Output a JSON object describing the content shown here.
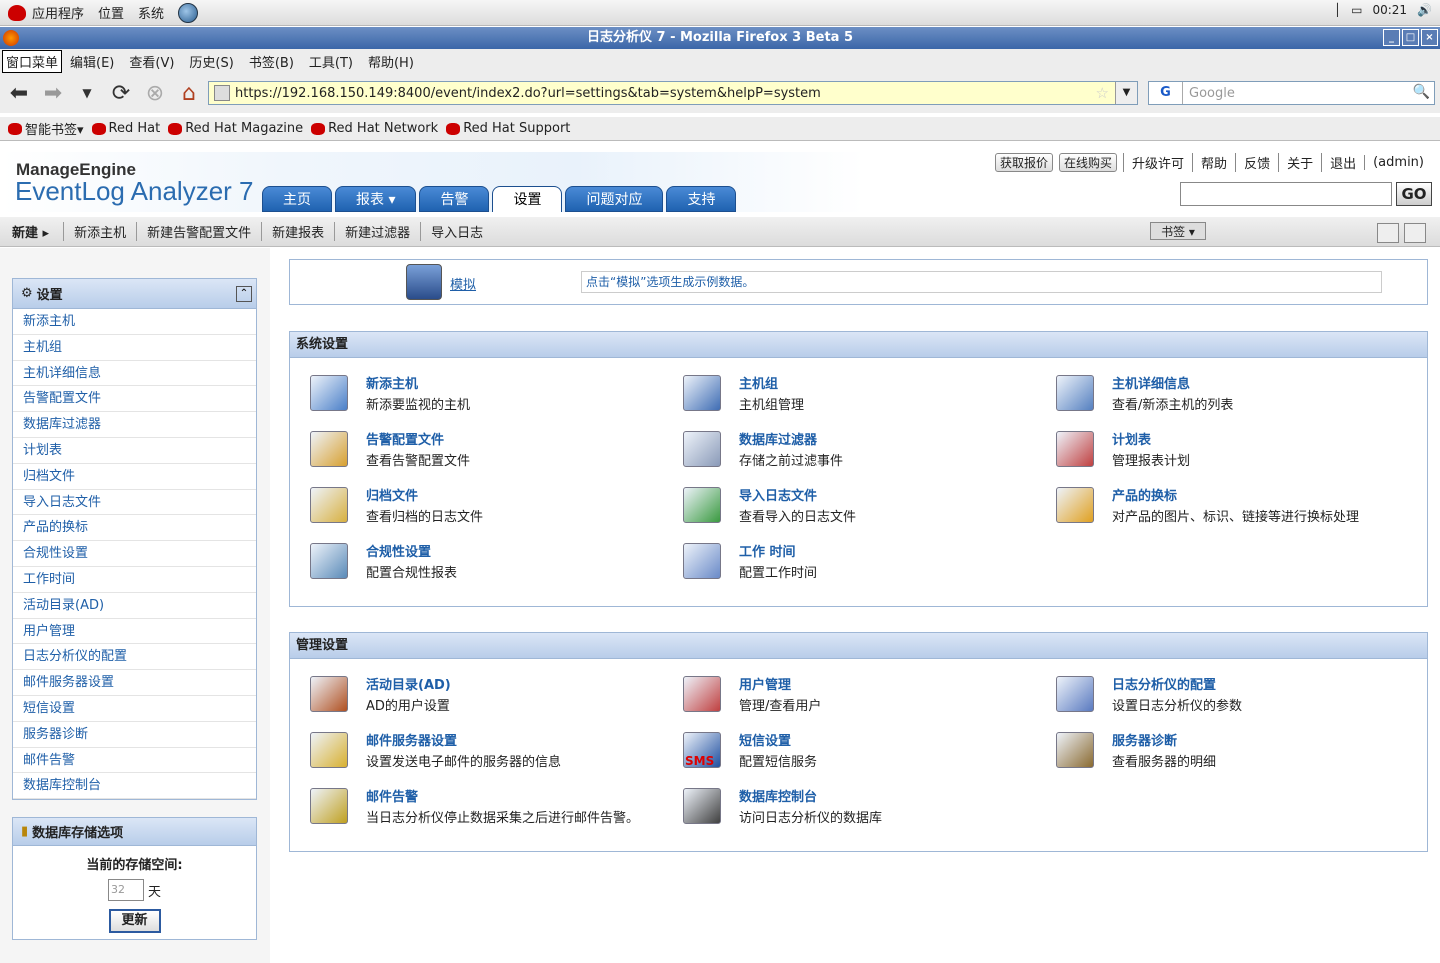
{
  "desktop": {
    "apps": "应用程序",
    "places": "位置",
    "system": "系统",
    "clock": "00:21"
  },
  "window": {
    "title": "日志分析仪 7 -  Mozilla Firefox 3 Beta 5"
  },
  "menu": {
    "items": [
      "窗口菜单",
      "编辑(E)",
      "查看(V)",
      "历史(S)",
      "书签(B)",
      "工具(T)",
      "帮助(H)"
    ]
  },
  "nav": {
    "url": "https://192.168.150.149:8400/event/index2.do?url=settings&tab=system&helpP=system",
    "search_placeholder": "Google",
    "search_engine": "G"
  },
  "bookmarks": [
    "智能书签▾",
    "Red Hat",
    "Red Hat Magazine",
    "Red Hat Network",
    "Red Hat Support"
  ],
  "brand": {
    "line1": "ManageEngine",
    "line2": "EventLog Analyzer 7"
  },
  "tabs": [
    "主页",
    "报表 ▾",
    "告警",
    "设置",
    "问题对应",
    "支持"
  ],
  "header_links": {
    "quote": "获取报价",
    "buy": "在线购买",
    "links": [
      "升级许可",
      "帮助",
      "反馈",
      "关于",
      "退出",
      "(admin)"
    ],
    "go": "GO"
  },
  "subbar": {
    "new": "新建 ▸",
    "items": [
      "新添主机",
      "新建告警配置文件",
      "新建报表",
      "新建过滤器",
      "导入日志"
    ],
    "bookmark": "书签 ▾"
  },
  "sidebar": {
    "title": "设置",
    "items": [
      "新添主机",
      "主机组",
      "主机详细信息",
      "告警配置文件",
      "数据库过滤器",
      "计划表",
      "归档文件",
      "导入日志文件",
      "产品的换标",
      "合规性设置",
      "工作时间",
      "活动目录(AD)",
      "用户管理",
      "日志分析仪的配置",
      "邮件服务器设置",
      "短信设置",
      "服务器诊断",
      "邮件告警",
      "数据库控制台"
    ]
  },
  "storage": {
    "title": "数据库存储选项",
    "label": "当前的存储空间:",
    "value": "32",
    "unit": "天",
    "button": "更新"
  },
  "simulate": {
    "link": "模拟",
    "hint": "点击“模拟”选项生成示例数据。"
  },
  "system_settings": {
    "title": "系统设置",
    "items": [
      {
        "t": "新添主机",
        "d": "新添要监视的主机"
      },
      {
        "t": "主机组",
        "d": "主机组管理"
      },
      {
        "t": "主机详细信息",
        "d": "查看/新添主机的列表"
      },
      {
        "t": "告警配置文件",
        "d": "查看告警配置文件"
      },
      {
        "t": "数据库过滤器",
        "d": "存储之前过滤事件"
      },
      {
        "t": "计划表",
        "d": "管理报表计划"
      },
      {
        "t": "归档文件",
        "d": "查看归档的日志文件"
      },
      {
        "t": "导入日志文件",
        "d": "查看导入的日志文件"
      },
      {
        "t": "产品的换标",
        "d": "对产品的图片、标识、链接等进行换标处理"
      },
      {
        "t": "合规性设置",
        "d": "配置合规性报表"
      },
      {
        "t": "工作 时间",
        "d": "配置工作时间"
      }
    ]
  },
  "admin_settings": {
    "title": "管理设置",
    "items": [
      {
        "t": "活动目录(AD)",
        "d": "AD的用户设置"
      },
      {
        "t": "用户管理",
        "d": "管理/查看用户"
      },
      {
        "t": "日志分析仪的配置",
        "d": "设置日志分析仪的参数"
      },
      {
        "t": "邮件服务器设置",
        "d": "设置发送电子邮件的服务器的信息"
      },
      {
        "t": "短信设置",
        "d": "配置短信服务"
      },
      {
        "t": "服务器诊断",
        "d": "查看服务器的明细"
      },
      {
        "t": "邮件告警",
        "d": "当日志分析仪停止数据采集之后进行邮件告警。"
      },
      {
        "t": "数据库控制台",
        "d": "访问日志分析仪的数据库"
      }
    ]
  },
  "sms_label": "SMS"
}
